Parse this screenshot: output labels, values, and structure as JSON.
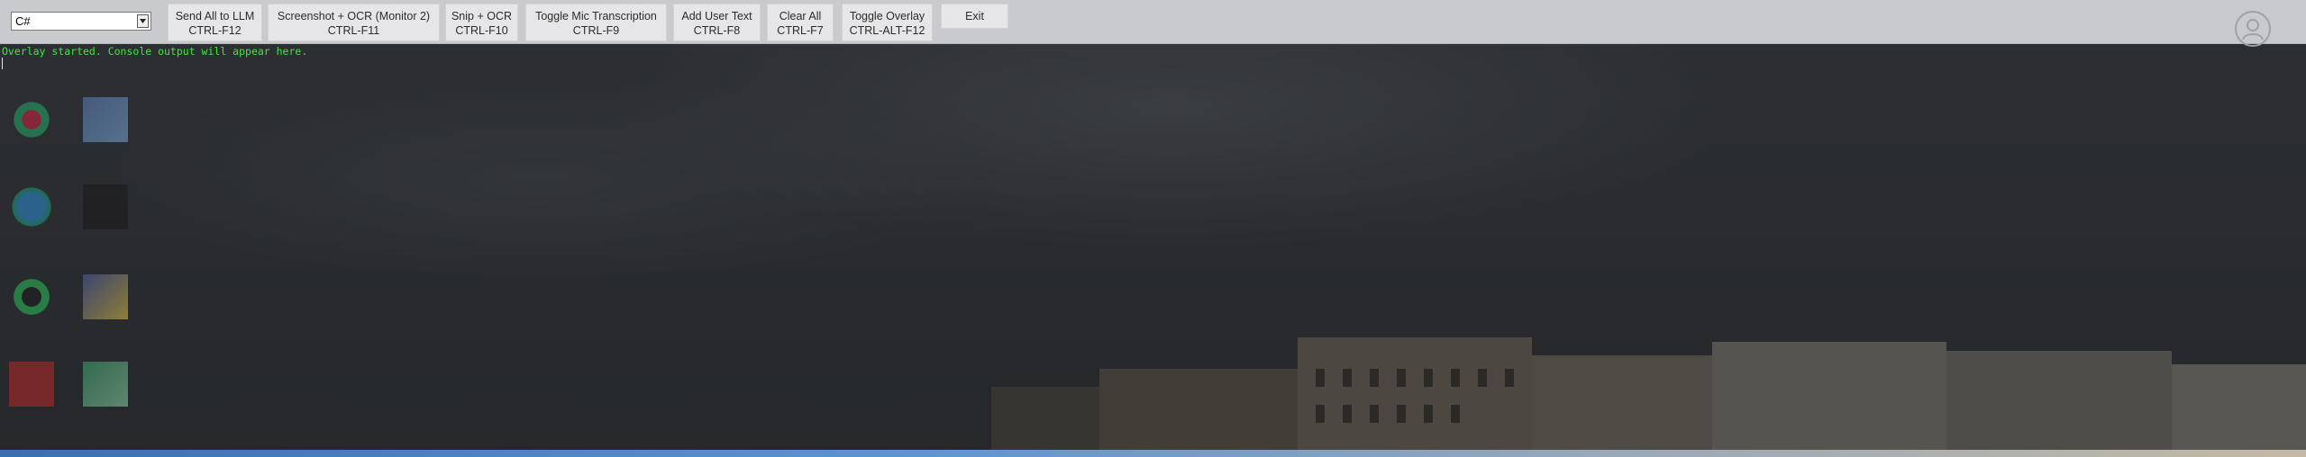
{
  "language_select": {
    "value": "C#"
  },
  "toolbar": {
    "buttons": [
      {
        "label": "Send All to LLM",
        "shortcut": "CTRL-F12"
      },
      {
        "label": "Screenshot + OCR (Monitor 2)",
        "shortcut": "CTRL-F11"
      },
      {
        "label": "Snip + OCR",
        "shortcut": "CTRL-F10"
      },
      {
        "label": "Toggle Mic Transcription",
        "shortcut": "CTRL-F9"
      },
      {
        "label": "Add User Text",
        "shortcut": "CTRL-F8"
      },
      {
        "label": "Clear All",
        "shortcut": "CTRL-F7"
      },
      {
        "label": "Toggle Overlay",
        "shortcut": "CTRL-ALT-F12"
      },
      {
        "label": "Exit",
        "shortcut": ""
      }
    ]
  },
  "console": {
    "line1": "Overlay started. Console output will appear here.",
    "text_color": "#3fe63f"
  },
  "colors": {
    "toolbar_bg": "#c9cace",
    "button_bg": "#e6e6e8",
    "overlay_bg": "#2a2c30"
  },
  "icons": {
    "select_arrow": "chevron-down-icon",
    "user_tray": "user-icon"
  }
}
